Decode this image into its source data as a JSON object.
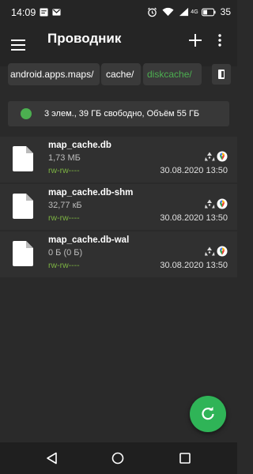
{
  "status_bar": {
    "time": "14:09",
    "battery": "35",
    "network": "4G",
    "icons": [
      "sms-icon",
      "gmail-icon",
      "alarm-icon",
      "wifi-icon",
      "signal-icon",
      "battery-icon"
    ]
  },
  "app_bar": {
    "title": "Проводник",
    "icons": [
      "menu-icon",
      "add-icon",
      "more-vert-icon"
    ]
  },
  "breadcrumbs": [
    {
      "label": "android.apps.maps/",
      "active": false
    },
    {
      "label": "cache/",
      "active": false
    },
    {
      "label": "diskcache/",
      "active": true
    }
  ],
  "storage": {
    "text": "3 элем., 39 ГБ свободно, Объём 55 ГБ"
  },
  "files": [
    {
      "name": "map_cache.db",
      "size": "1,73 МБ",
      "permissions": "rw-rw----",
      "date": "30.08.2020 13:50"
    },
    {
      "name": "map_cache.db-shm",
      "size": "32,77 кБ",
      "permissions": "rw-rw----",
      "date": "30.08.2020 13:50"
    },
    {
      "name": "map_cache.db-wal",
      "size": "0 Б (0 Б)",
      "permissions": "rw-rw----",
      "date": "30.08.2020 13:50"
    }
  ],
  "colors": {
    "accent": "#2fb457",
    "permissions": "#7cb342",
    "active_crumb": "#4caf50"
  }
}
